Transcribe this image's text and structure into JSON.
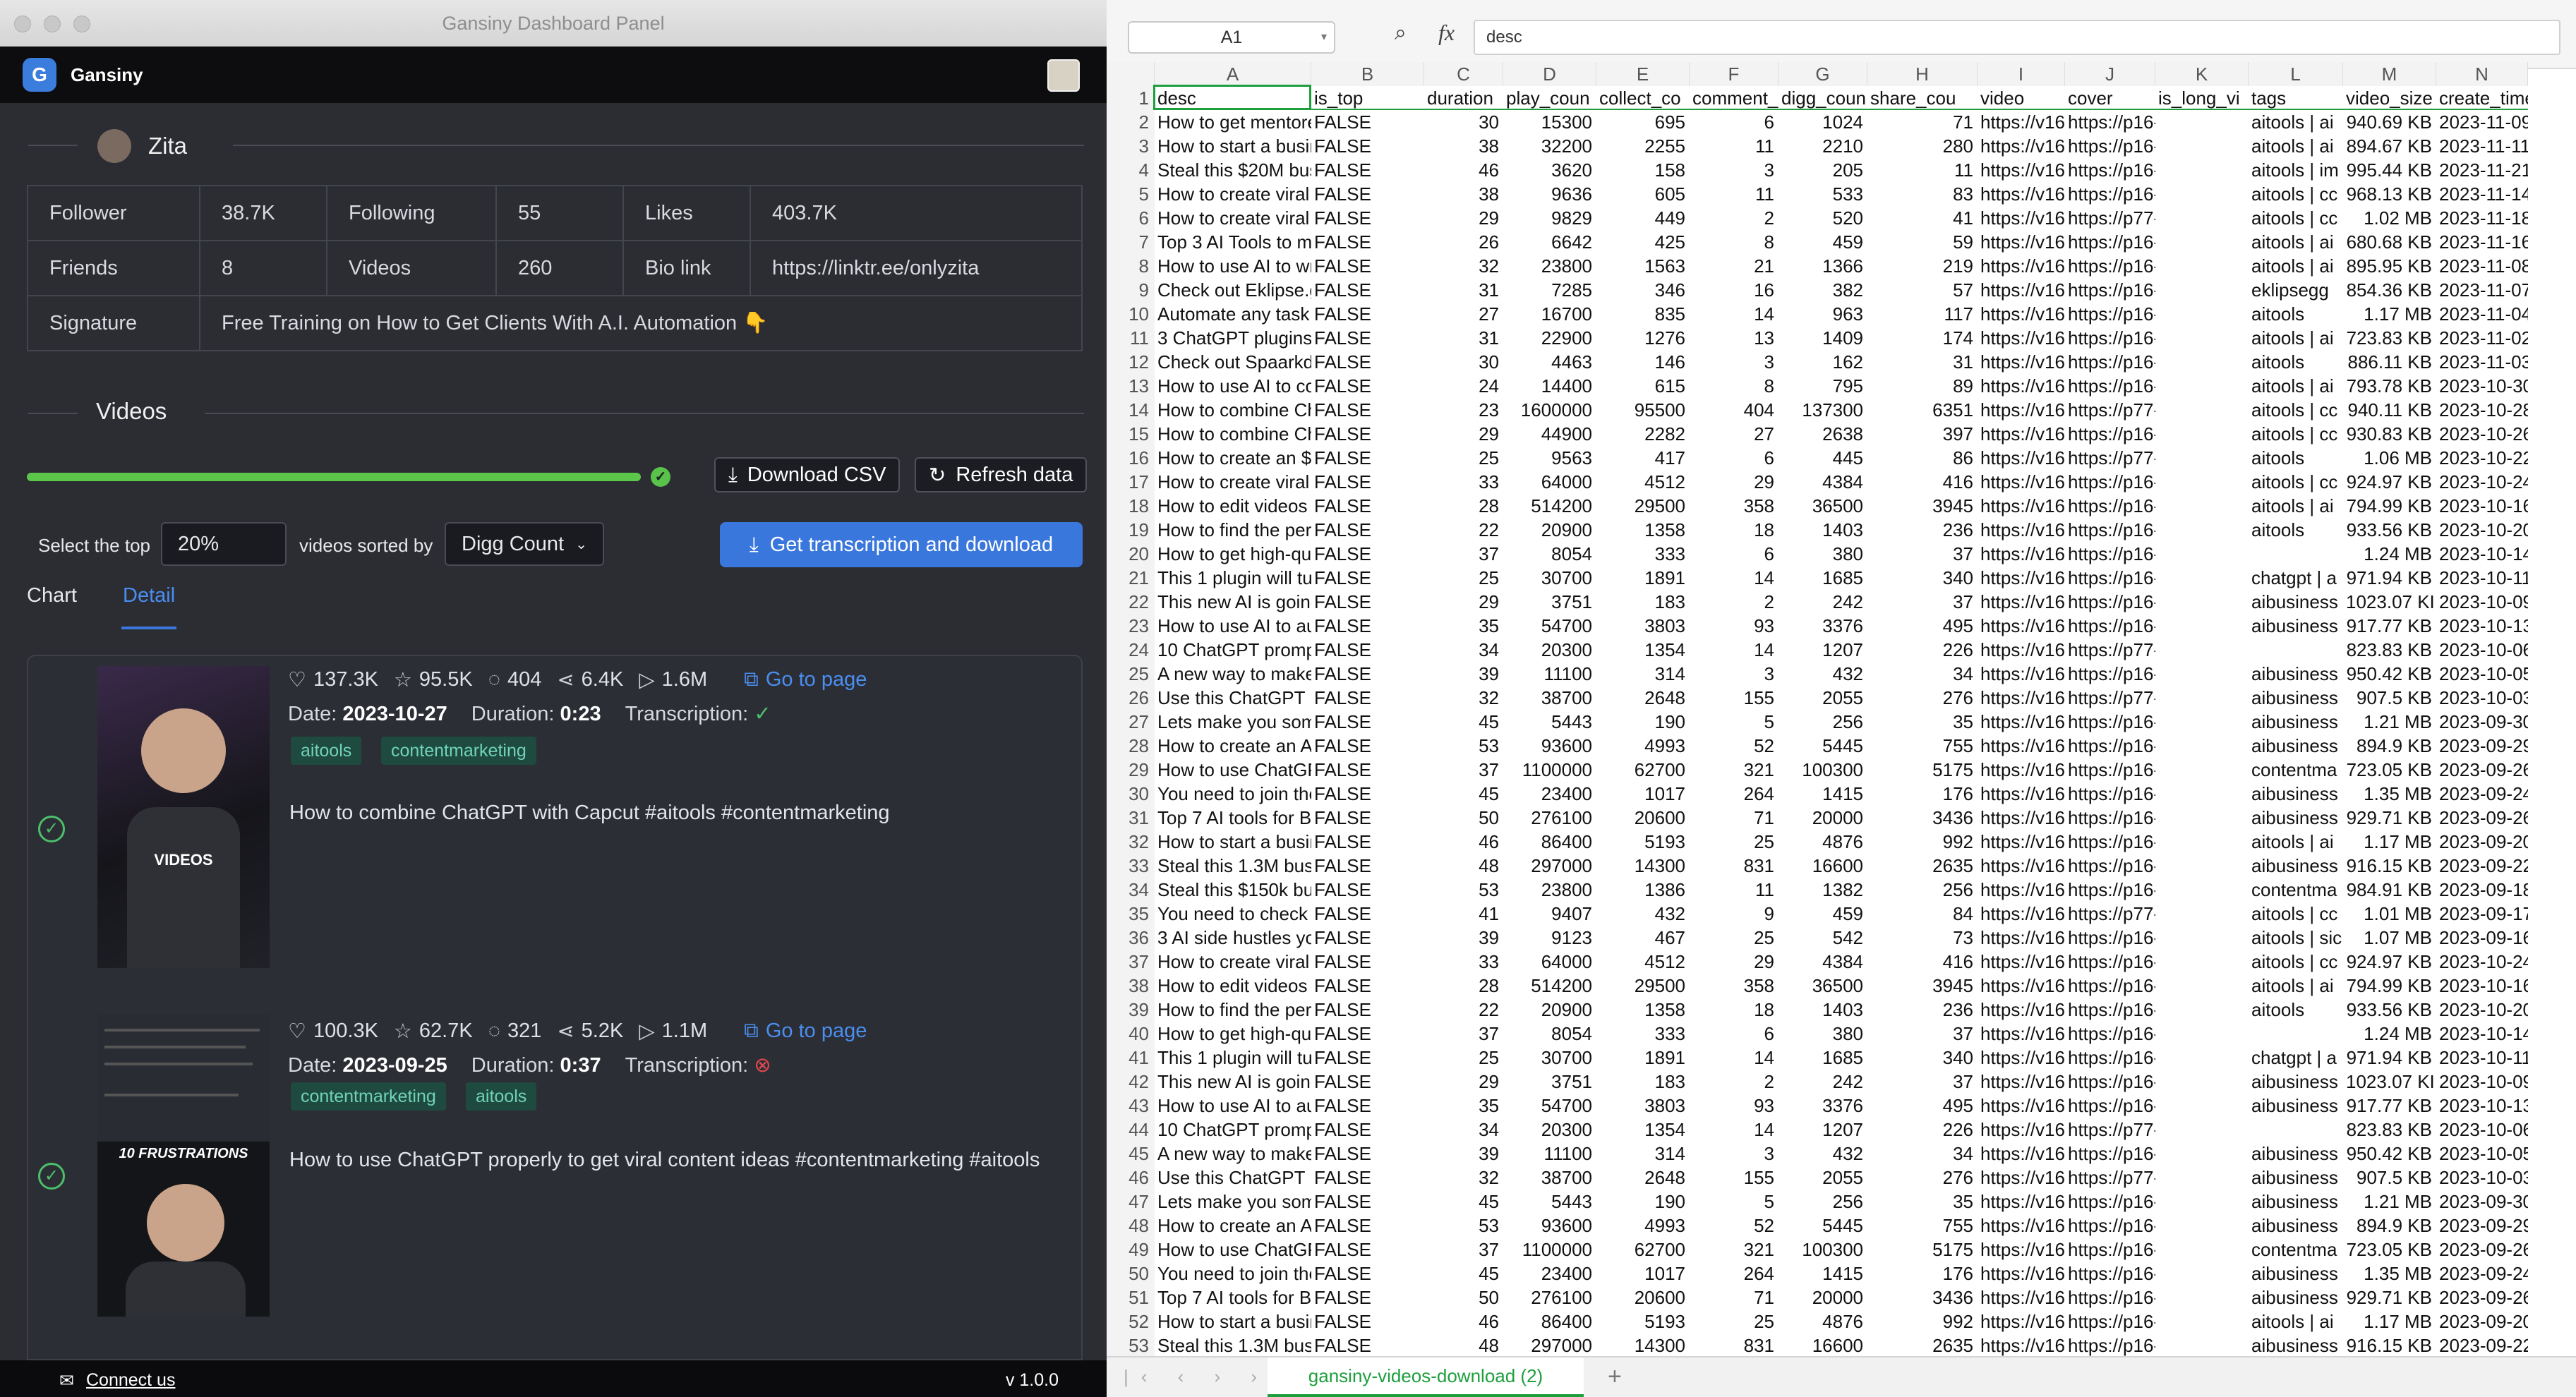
{
  "window": {
    "title": "Gansiny Dashboard Panel"
  },
  "app": {
    "brand": "Gansiny",
    "version": "v 1.0.0",
    "connect": "Connect us"
  },
  "profile": {
    "name": "Zita",
    "labels": {
      "follower": "Follower",
      "following": "Following",
      "likes": "Likes",
      "friends": "Friends",
      "videos": "Videos",
      "biolink": "Bio link",
      "signature": "Signature"
    },
    "values": {
      "follower": "38.7K",
      "following": "55",
      "likes": "403.7K",
      "friends": "8",
      "videos": "260",
      "biolink": "https://linktr.ee/onlyzita",
      "signature": "Free Training on How to Get Clients With A.I. Automation 👇"
    }
  },
  "videos_section": {
    "title": "Videos",
    "progress": 1.0,
    "download_csv": "Download CSV",
    "refresh": "Refresh data",
    "select_label": "Select the top",
    "top_value": "20%",
    "sorted_label": "videos sorted by",
    "sort_value": "Digg Count",
    "transcribe_btn": "Get transcription and download",
    "tabs": [
      "Chart",
      "Detail"
    ],
    "active_tab": "Detail"
  },
  "videos": [
    {
      "likes": "137.3K",
      "favs": "95.5K",
      "comments": "404",
      "shares": "6.4K",
      "plays": "1.6M",
      "go": "Go to page",
      "date_label": "Date:",
      "date": "2023-10-27",
      "duration_label": "Duration:",
      "duration": "0:23",
      "transcription_label": "Transcription:",
      "transcribed": true,
      "tags": [
        "aitools",
        "contentmarketing"
      ],
      "desc": "How to combine ChatGPT with Capcut #aitools #contentmarketing",
      "thumb_text": "VIDEOS"
    },
    {
      "likes": "100.3K",
      "favs": "62.7K",
      "comments": "321",
      "shares": "5.2K",
      "plays": "1.1M",
      "go": "Go to page",
      "date_label": "Date:",
      "date": "2023-09-25",
      "duration_label": "Duration:",
      "duration": "0:37",
      "transcription_label": "Transcription:",
      "transcribed": false,
      "tags": [
        "contentmarketing",
        "aitools"
      ],
      "desc": "How to use ChatGPT properly to get viral content ideas #contentmarketing #aitools",
      "thumb_text": "10 FRUSTRATIONS"
    }
  ],
  "sheet": {
    "cell_ref": "A1",
    "formula": "desc",
    "tab_name": "gansiny-videos-download (2)",
    "columns": [
      "A",
      "B",
      "C",
      "D",
      "E",
      "F",
      "G",
      "H",
      "I",
      "J",
      "K",
      "L",
      "M",
      "N"
    ],
    "headers": [
      "desc",
      "is_top",
      "duration",
      "play_coun",
      "collect_co",
      "comment_",
      "digg_coun",
      "share_cou",
      "video",
      "cover",
      "is_long_vi",
      "tags",
      "video_size",
      "create_time"
    ],
    "rows": [
      [
        "How to get mentore",
        "FALSE",
        "30",
        "15300",
        "695",
        "6",
        "1024",
        "71",
        "https://v16",
        "https://p16-sign-va.til",
        "aitools | ai",
        "940.69 KB",
        "2023-11-09"
      ],
      [
        "How to start a busin",
        "FALSE",
        "38",
        "32200",
        "2255",
        "11",
        "2210",
        "280",
        "https://v16",
        "https://p16-sign-va.til",
        "aitools | ai",
        "894.67 KB",
        "2023-11-11"
      ],
      [
        "Steal this $20M busi",
        "FALSE",
        "46",
        "3620",
        "158",
        "3",
        "205",
        "11",
        "https://v16",
        "https://p16-sign-va.til",
        "aitools | im",
        "995.44 KB",
        "2023-11-21"
      ],
      [
        "How to create viral s",
        "FALSE",
        "38",
        "9636",
        "605",
        "11",
        "533",
        "83",
        "https://v16",
        "https://p16-sign-va.til",
        "aitools | cc",
        "968.13 KB",
        "2023-11-14"
      ],
      [
        "How to create viral s",
        "FALSE",
        "29",
        "9829",
        "449",
        "2",
        "520",
        "41",
        "https://v16",
        "https://p77-sign-va.til",
        "aitools | cc",
        "1.02 MB",
        "2023-11-18"
      ],
      [
        "Top 3 AI Tools to ma",
        "FALSE",
        "26",
        "6642",
        "425",
        "8",
        "459",
        "59",
        "https://v16",
        "https://p16-sign-va.til",
        "aitools | ai",
        "680.68 KB",
        "2023-11-16"
      ],
      [
        "How to use AI to wri",
        "FALSE",
        "32",
        "23800",
        "1563",
        "21",
        "1366",
        "219",
        "https://v16",
        "https://p16-sign-va.til",
        "aitools | ai",
        "895.95 KB",
        "2023-11-08"
      ],
      [
        "Check out Eklipse.g",
        "FALSE",
        "31",
        "7285",
        "346",
        "16",
        "382",
        "57",
        "https://v16",
        "https://p16-sign-va.til",
        "eklipsegg",
        "854.36 KB",
        "2023-11-07"
      ],
      [
        "Automate any task v",
        "FALSE",
        "27",
        "16700",
        "835",
        "14",
        "963",
        "117",
        "https://v16",
        "https://p16-sign-va.til",
        "aitools",
        "1.17 MB",
        "2023-11-04"
      ],
      [
        "3 ChatGPT plugins e",
        "FALSE",
        "31",
        "22900",
        "1276",
        "13",
        "1409",
        "174",
        "https://v16",
        "https://p16-sign-va.til",
        "aitools | ai",
        "723.83 KB",
        "2023-11-02"
      ],
      [
        "Check out Spaarkd",
        "FALSE",
        "30",
        "4463",
        "146",
        "3",
        "162",
        "31",
        "https://v16",
        "https://p16-sign-va.til",
        "aitools",
        "886.11 KB",
        "2023-11-03"
      ],
      [
        "How to use AI to co",
        "FALSE",
        "24",
        "14400",
        "615",
        "8",
        "795",
        "89",
        "https://v16",
        "https://p16-sign-va.til",
        "aitools | ai",
        "793.78 KB",
        "2023-10-30"
      ],
      [
        "How to combine Cha",
        "FALSE",
        "23",
        "1600000",
        "95500",
        "404",
        "137300",
        "6351",
        "https://v16",
        "https://p77-sign-va.til",
        "aitools | cc",
        "940.11 KB",
        "2023-10-28"
      ],
      [
        "How to combine Cha",
        "FALSE",
        "29",
        "44900",
        "2282",
        "27",
        "2638",
        "397",
        "https://v16",
        "https://p16-sign-va.til",
        "aitools | cc",
        "930.83 KB",
        "2023-10-26"
      ],
      [
        "How to create an $1",
        "FALSE",
        "25",
        "9563",
        "417",
        "6",
        "445",
        "86",
        "https://v16",
        "https://p77-sign-va.til",
        "aitools",
        "1.06 MB",
        "2023-10-22"
      ],
      [
        "How to create viral v",
        "FALSE",
        "33",
        "64000",
        "4512",
        "29",
        "4384",
        "416",
        "https://v16",
        "https://p16-sign-va.til",
        "aitools | cc",
        "924.97 KB",
        "2023-10-24"
      ],
      [
        "How to edit videos u",
        "FALSE",
        "28",
        "514200",
        "29500",
        "358",
        "36500",
        "3945",
        "https://v16",
        "https://p16-sign-va.til",
        "aitools | ai",
        "794.99 KB",
        "2023-10-16"
      ],
      [
        "How to find the perfe",
        "FALSE",
        "22",
        "20900",
        "1358",
        "18",
        "1403",
        "236",
        "https://v16",
        "https://p16-sign-va.til",
        "aitools",
        "933.56 KB",
        "2023-10-20"
      ],
      [
        "How to get high-qua",
        "FALSE",
        "37",
        "8054",
        "333",
        "6",
        "380",
        "37",
        "https://v16",
        "https://p16-sign-va.tiktokcdn.coi",
        "",
        "1.24 MB",
        "2023-10-14"
      ],
      [
        "This 1 plugin will turi",
        "FALSE",
        "25",
        "30700",
        "1891",
        "14",
        "1685",
        "340",
        "https://v16",
        "https://p16-sign-va.til",
        "chatgpt | a",
        "971.94 KB",
        "2023-10-11"
      ],
      [
        "This new AI is going",
        "FALSE",
        "29",
        "3751",
        "183",
        "2",
        "242",
        "37",
        "https://v16",
        "https://p16-sign-va.til",
        "aibusiness",
        "1023.07 KI",
        "2023-10-09"
      ],
      [
        "How to use AI to aut",
        "FALSE",
        "35",
        "54700",
        "3803",
        "93",
        "3376",
        "495",
        "https://v16",
        "https://p16-sign-va.til",
        "aibusiness",
        "917.77 KB",
        "2023-10-13"
      ],
      [
        "10 ChatGPT prompt",
        "FALSE",
        "34",
        "20300",
        "1354",
        "14",
        "1207",
        "226",
        "https://v16",
        "https://p77-sign-va.tiktokcdn.coi",
        "",
        "823.83 KB",
        "2023-10-06"
      ],
      [
        "A new way to make",
        "FALSE",
        "39",
        "11100",
        "314",
        "3",
        "432",
        "34",
        "https://v16",
        "https://p16-sign-va.til",
        "aibusiness",
        "950.42 KB",
        "2023-10-05"
      ],
      [
        "Use this ChatGPT pi",
        "FALSE",
        "32",
        "38700",
        "2648",
        "155",
        "2055",
        "276",
        "https://v16",
        "https://p77-sign-va.til",
        "aibusiness",
        "907.5 KB",
        "2023-10-03"
      ],
      [
        "Lets make you some",
        "FALSE",
        "45",
        "5443",
        "190",
        "5",
        "256",
        "35",
        "https://v16",
        "https://p16-sign-va.til",
        "aibusiness",
        "1.21 MB",
        "2023-09-30"
      ],
      [
        "How to create an AI",
        "FALSE",
        "53",
        "93600",
        "4993",
        "52",
        "5445",
        "755",
        "https://v16",
        "https://p16-sign-va.til",
        "aibusiness",
        "894.9 KB",
        "2023-09-29"
      ],
      [
        "How to use ChatGPT",
        "FALSE",
        "37",
        "1100000",
        "62700",
        "321",
        "100300",
        "5175",
        "https://v16",
        "https://p16-sign-va.til",
        "contentma",
        "723.05 KB",
        "2023-09-26"
      ],
      [
        "You need to join the",
        "FALSE",
        "45",
        "23400",
        "1017",
        "264",
        "1415",
        "176",
        "https://v16",
        "https://p16-sign-va.til",
        "aibusiness",
        "1.35 MB",
        "2023-09-24"
      ],
      [
        "Top 7 AI tools for Bu",
        "FALSE",
        "50",
        "276100",
        "20600",
        "71",
        "20000",
        "3436",
        "https://v16",
        "https://p16-sign-va.til",
        "aibusiness",
        "929.71 KB",
        "2023-09-26"
      ],
      [
        "How to start a busin",
        "FALSE",
        "46",
        "86400",
        "5193",
        "25",
        "4876",
        "992",
        "https://v16",
        "https://p16-sign-va.til",
        "aitools | ai",
        "1.17 MB",
        "2023-09-20"
      ],
      [
        "Steal this 1.3M busir",
        "FALSE",
        "48",
        "297000",
        "14300",
        "831",
        "16600",
        "2635",
        "https://v16",
        "https://p16-sign-va.til",
        "aibusiness",
        "916.15 KB",
        "2023-09-22"
      ],
      [
        "Steal this $150k bus",
        "FALSE",
        "53",
        "23800",
        "1386",
        "11",
        "1382",
        "256",
        "https://v16",
        "https://p16-sign-va.til",
        "contentma",
        "984.91 KB",
        "2023-09-18"
      ],
      [
        "You need to check c",
        "FALSE",
        "41",
        "9407",
        "432",
        "9",
        "459",
        "84",
        "https://v16",
        "https://p77-sign-va.til",
        "aitools | cc",
        "1.01 MB",
        "2023-09-17"
      ],
      [
        "3 AI side hustles you",
        "FALSE",
        "39",
        "9123",
        "467",
        "25",
        "542",
        "73",
        "https://v16",
        "https://p16-sign-va.til",
        "aitools | sic",
        "1.07 MB",
        "2023-09-16"
      ],
      [
        "How to create viral v",
        "FALSE",
        "33",
        "64000",
        "4512",
        "29",
        "4384",
        "416",
        "https://v16",
        "https://p16-sign-va.til",
        "aitools | cc",
        "924.97 KB",
        "2023-10-24"
      ],
      [
        "How to edit videos u",
        "FALSE",
        "28",
        "514200",
        "29500",
        "358",
        "36500",
        "3945",
        "https://v16",
        "https://p16-sign-va.til",
        "aitools | ai",
        "794.99 KB",
        "2023-10-16"
      ],
      [
        "How to find the perfe",
        "FALSE",
        "22",
        "20900",
        "1358",
        "18",
        "1403",
        "236",
        "https://v16",
        "https://p16-sign-va.til",
        "aitools",
        "933.56 KB",
        "2023-10-20"
      ],
      [
        "How to get high-qua",
        "FALSE",
        "37",
        "8054",
        "333",
        "6",
        "380",
        "37",
        "https://v16",
        "https://p16-sign-va.tiktokcdn.coi",
        "",
        "1.24 MB",
        "2023-10-14"
      ],
      [
        "This 1 plugin will turi",
        "FALSE",
        "25",
        "30700",
        "1891",
        "14",
        "1685",
        "340",
        "https://v16",
        "https://p16-sign-va.til",
        "chatgpt | a",
        "971.94 KB",
        "2023-10-11"
      ],
      [
        "This new AI is going",
        "FALSE",
        "29",
        "3751",
        "183",
        "2",
        "242",
        "37",
        "https://v16",
        "https://p16-sign-va.til",
        "aibusiness",
        "1023.07 KI",
        "2023-10-09"
      ],
      [
        "How to use AI to aut",
        "FALSE",
        "35",
        "54700",
        "3803",
        "93",
        "3376",
        "495",
        "https://v16",
        "https://p16-sign-va.til",
        "aibusiness",
        "917.77 KB",
        "2023-10-13"
      ],
      [
        "10 ChatGPT prompt",
        "FALSE",
        "34",
        "20300",
        "1354",
        "14",
        "1207",
        "226",
        "https://v16",
        "https://p77-sign-va.tiktokcdn.coi",
        "",
        "823.83 KB",
        "2023-10-06"
      ],
      [
        "A new way to make",
        "FALSE",
        "39",
        "11100",
        "314",
        "3",
        "432",
        "34",
        "https://v16",
        "https://p16-sign-va.til",
        "aibusiness",
        "950.42 KB",
        "2023-10-05"
      ],
      [
        "Use this ChatGPT pi",
        "FALSE",
        "32",
        "38700",
        "2648",
        "155",
        "2055",
        "276",
        "https://v16",
        "https://p77-sign-va.til",
        "aibusiness",
        "907.5 KB",
        "2023-10-03"
      ],
      [
        "Lets make you some",
        "FALSE",
        "45",
        "5443",
        "190",
        "5",
        "256",
        "35",
        "https://v16",
        "https://p16-sign-va.til",
        "aibusiness",
        "1.21 MB",
        "2023-09-30"
      ],
      [
        "How to create an AI",
        "FALSE",
        "53",
        "93600",
        "4993",
        "52",
        "5445",
        "755",
        "https://v16",
        "https://p16-sign-va.til",
        "aibusiness",
        "894.9 KB",
        "2023-09-29"
      ],
      [
        "How to use ChatGPT",
        "FALSE",
        "37",
        "1100000",
        "62700",
        "321",
        "100300",
        "5175",
        "https://v16",
        "https://p16-sign-va.til",
        "contentma",
        "723.05 KB",
        "2023-09-26"
      ],
      [
        "You need to join the",
        "FALSE",
        "45",
        "23400",
        "1017",
        "264",
        "1415",
        "176",
        "https://v16",
        "https://p16-sign-va.til",
        "aibusiness",
        "1.35 MB",
        "2023-09-24"
      ],
      [
        "Top 7 AI tools for Bu",
        "FALSE",
        "50",
        "276100",
        "20600",
        "71",
        "20000",
        "3436",
        "https://v16",
        "https://p16-sign-va.til",
        "aibusiness",
        "929.71 KB",
        "2023-09-26"
      ],
      [
        "How to start a busin",
        "FALSE",
        "46",
        "86400",
        "5193",
        "25",
        "4876",
        "992",
        "https://v16",
        "https://p16-sign-va.til",
        "aitools | ai",
        "1.17 MB",
        "2023-09-20"
      ],
      [
        "Steal this 1.3M busir",
        "FALSE",
        "48",
        "297000",
        "14300",
        "831",
        "16600",
        "2635",
        "https://v16",
        "https://p16-sign-va.til",
        "aibusiness",
        "916.15 KB",
        "2023-09-22"
      ]
    ]
  },
  "colors": {
    "accent": "#3a77dd",
    "success": "#58c24a",
    "tag_bg": "#1f4a40",
    "tag_fg": "#6fd3b6",
    "sheet_tab": "#1e9f3d"
  }
}
